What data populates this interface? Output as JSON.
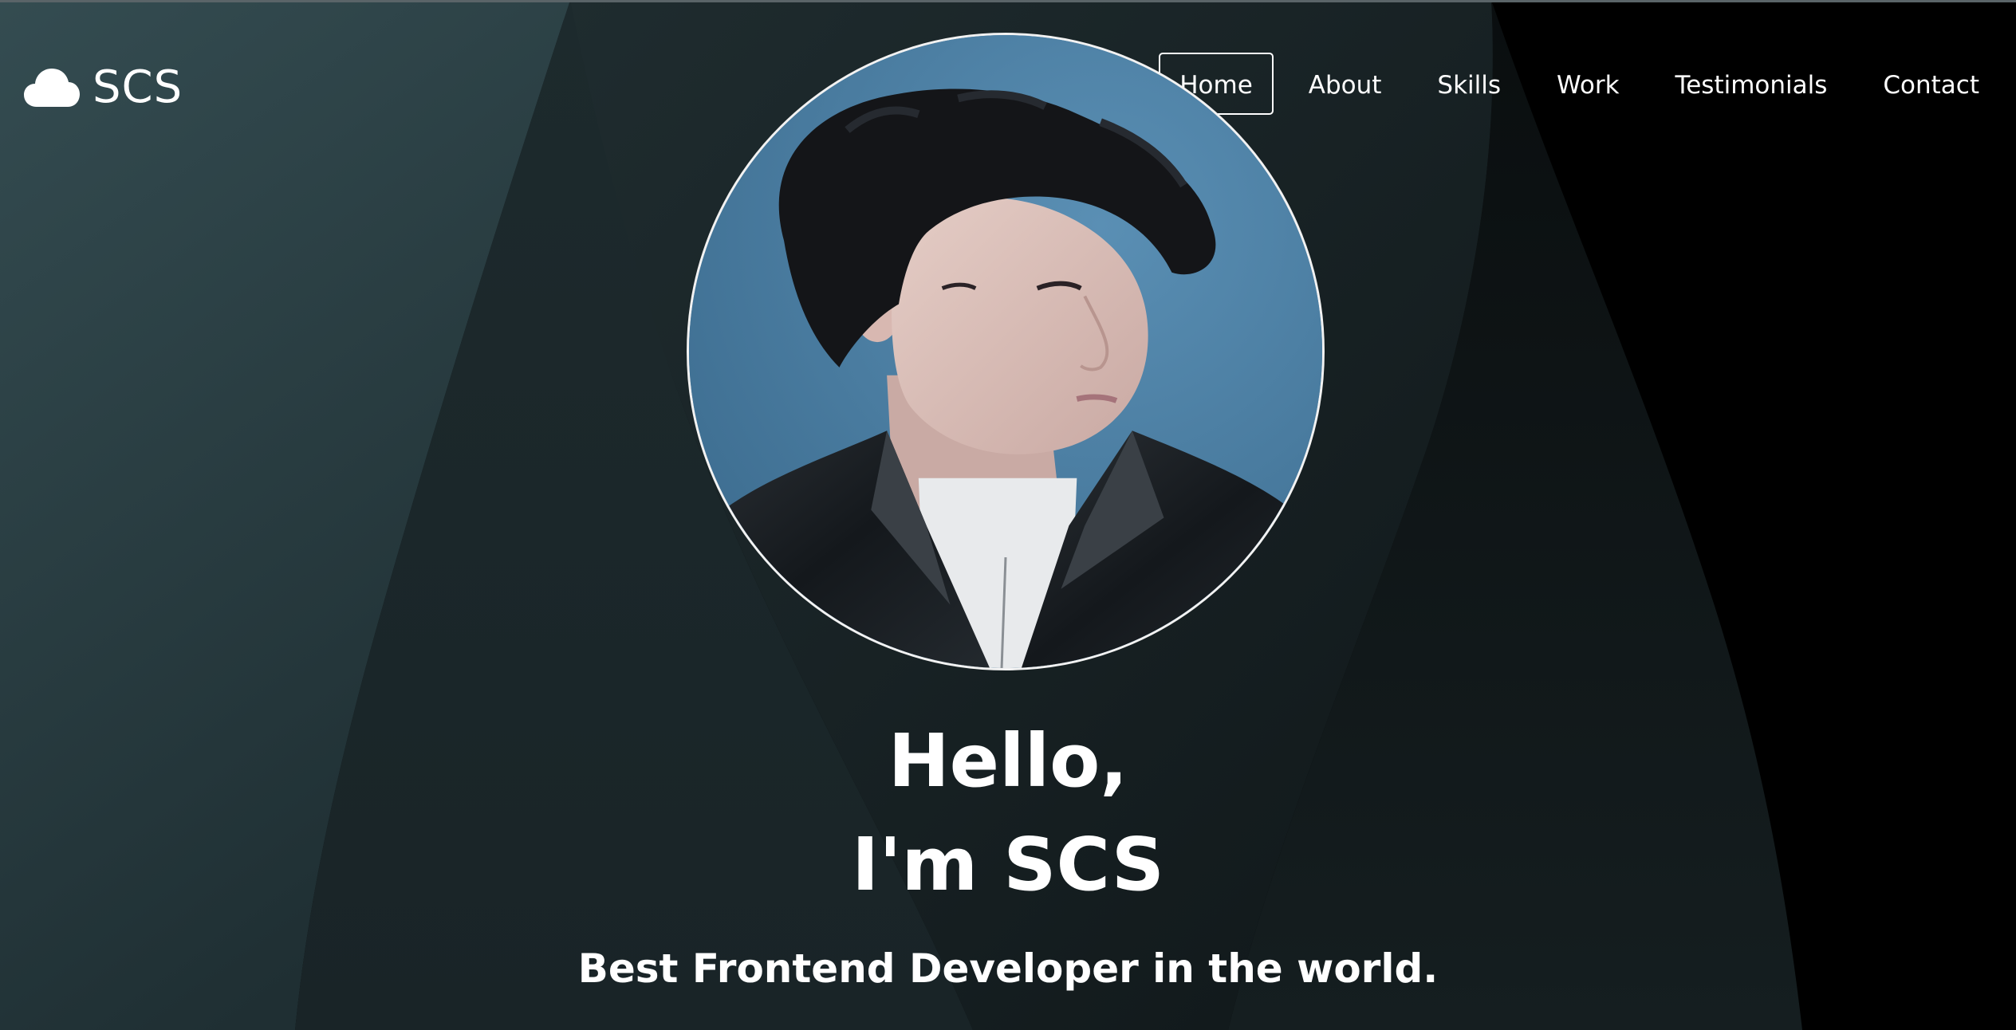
{
  "brand": {
    "name": "SCS",
    "icon": "cloud-icon"
  },
  "nav": {
    "items": [
      {
        "label": "Home",
        "active": true
      },
      {
        "label": "About",
        "active": false
      },
      {
        "label": "Skills",
        "active": false
      },
      {
        "label": "Work",
        "active": false
      },
      {
        "label": "Testimonials",
        "active": false
      },
      {
        "label": "Contact",
        "active": false
      }
    ]
  },
  "hero": {
    "greeting_line1": "Hello,",
    "greeting_line2": "I'm SCS",
    "tagline": "Best Frontend Developer in the world.",
    "portrait_alt": "profile-photo"
  },
  "colors": {
    "background_dark": "#000000",
    "panel_left": "#2f474c",
    "panel_mid": "#1c2a2d",
    "text": "#ffffff",
    "accent_border": "#ffffff"
  }
}
